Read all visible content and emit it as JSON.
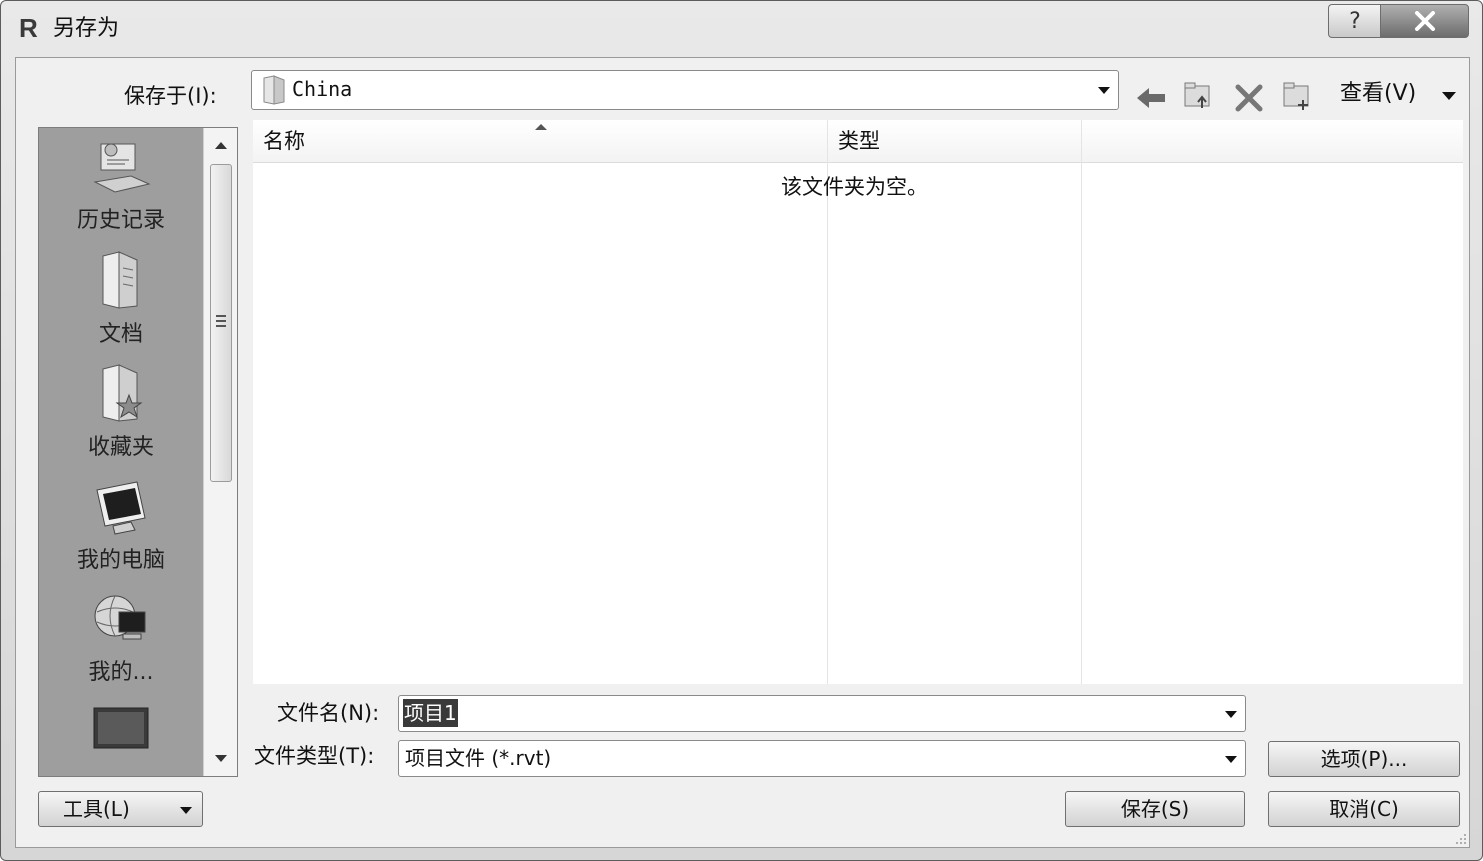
{
  "window": {
    "title": "另存为",
    "app_icon_letter": "R",
    "help_glyph": "?"
  },
  "save_in": {
    "label": "保存于(I):",
    "value": "China"
  },
  "toolbar": {
    "view_label": "查看(V)"
  },
  "places": {
    "items": [
      {
        "label": "历史记录",
        "icon": "history-icon"
      },
      {
        "label": "文档",
        "icon": "documents-folder-icon"
      },
      {
        "label": "收藏夹",
        "icon": "favorites-folder-icon"
      },
      {
        "label": "我的电脑",
        "icon": "computer-icon"
      },
      {
        "label": "我的...",
        "icon": "network-icon"
      },
      {
        "label": "",
        "icon": "desktop-icon"
      }
    ]
  },
  "file_list": {
    "columns": [
      "名称",
      "类型"
    ],
    "empty_message": "该文件夹为空。"
  },
  "filename": {
    "label": "文件名(N):",
    "value": "项目1"
  },
  "filetype": {
    "label": "文件类型(T):",
    "value": "项目文件 (*.rvt)"
  },
  "buttons": {
    "options": "选项(P)...",
    "tools": "工具(L)",
    "save": "保存(S)",
    "cancel": "取消(C)"
  }
}
